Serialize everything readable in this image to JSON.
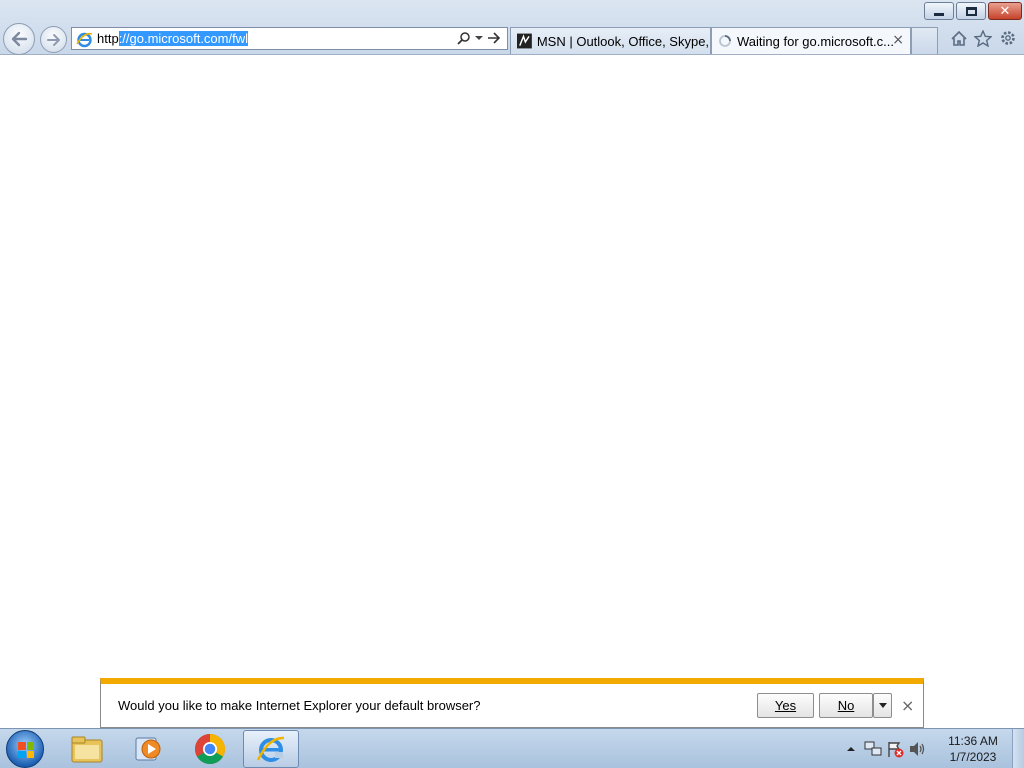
{
  "window": {
    "minimize_icon": "minimize-icon",
    "maximize_icon": "restore-icon",
    "close_icon": "close-icon"
  },
  "nav": {
    "back_icon": "back-arrow-icon",
    "forward_icon": "forward-arrow-icon"
  },
  "address_bar": {
    "url_prefix": "http",
    "url_selected": "://go.microsoft.com/fwl",
    "page_icon": "ie-page-icon",
    "search_icon": "search-icon",
    "go_icon": "go-arrow-icon"
  },
  "tabs": [
    {
      "label": "MSN | Outlook, Office, Skype, ...",
      "icon": "msn-icon",
      "active": false
    },
    {
      "label": "Waiting for go.microsoft.c...",
      "icon": "loading-spinner-icon",
      "active": true,
      "close": "×"
    }
  ],
  "toolbar": {
    "home_icon": "home-icon",
    "favorites_icon": "star-icon",
    "tools_icon": "gear-icon"
  },
  "notification": {
    "message": "Would you like to make Internet Explorer your default browser?",
    "yes_label": "Yes",
    "no_label": "No",
    "close": "×",
    "accent_color": "#f2a900"
  },
  "taskbar": {
    "apps": [
      "file-explorer-icon",
      "media-player-icon",
      "chrome-icon",
      "internet-explorer-icon"
    ],
    "tray_icons": [
      "show-hidden-icons",
      "network-icon",
      "action-center-icon",
      "volume-icon"
    ],
    "time": "11:36 AM",
    "date": "1/7/2023"
  }
}
